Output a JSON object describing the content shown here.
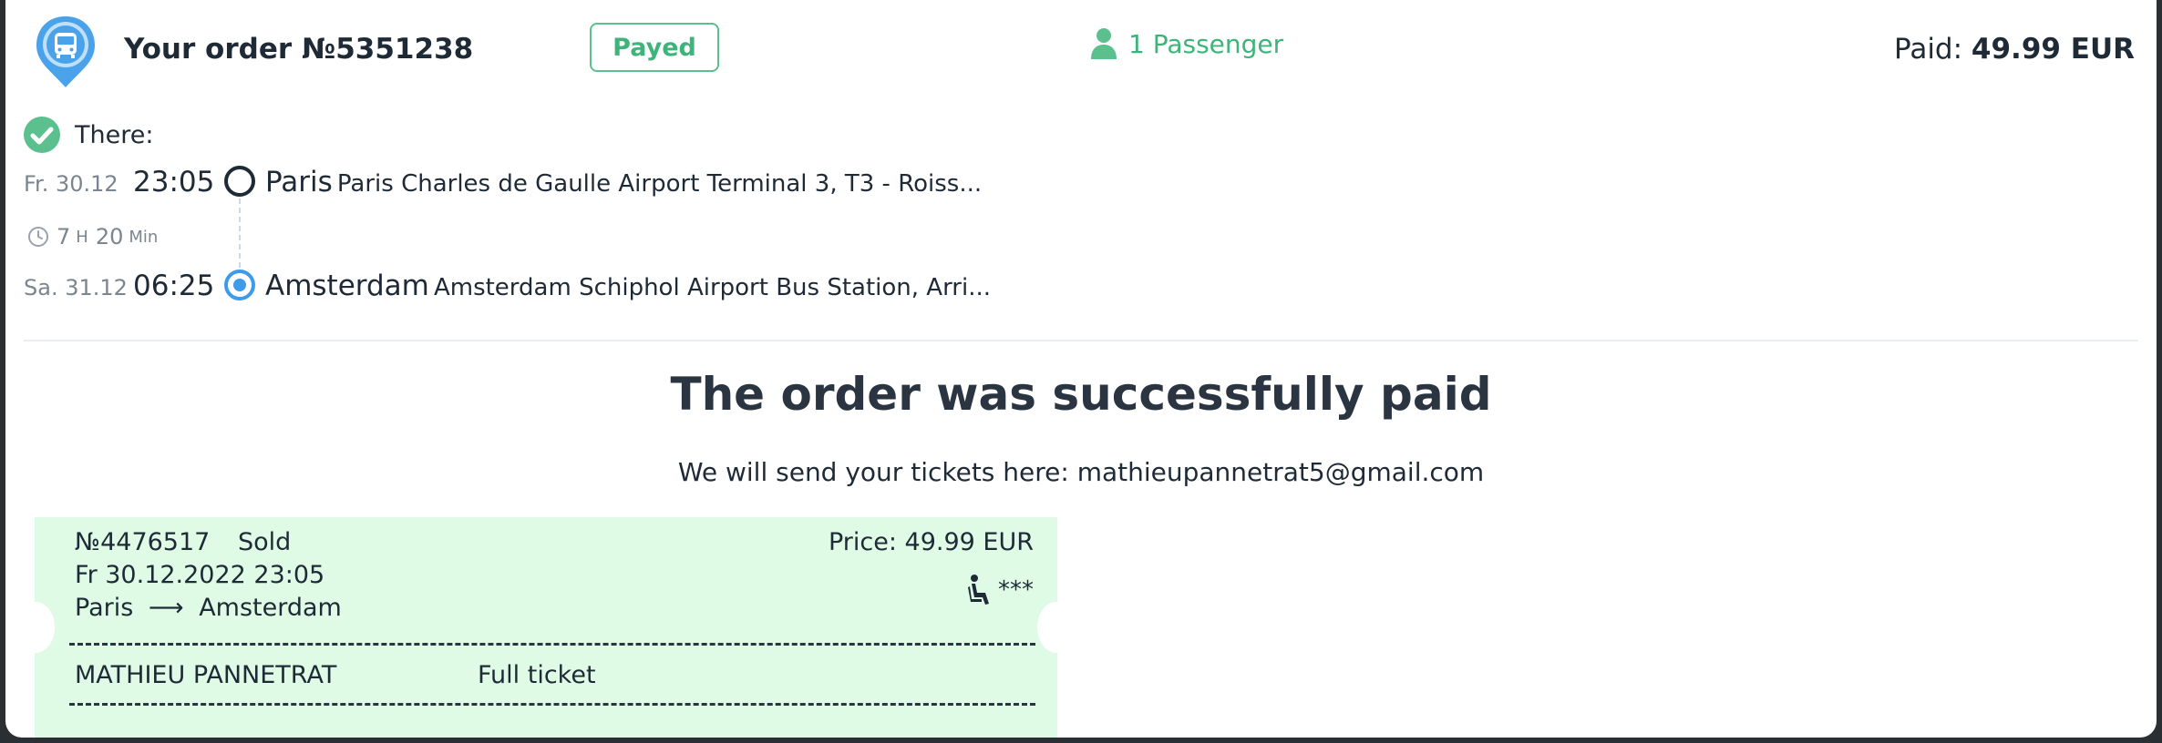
{
  "header": {
    "order_title": "Your order №5351238",
    "status": "Payed",
    "passengers": "1 Passenger",
    "paid_label": "Paid:",
    "paid_amount": "49.99 EUR"
  },
  "route": {
    "direction_label": "There:",
    "departure": {
      "date": "Fr. 30.12",
      "time": "23:05",
      "city": "Paris",
      "address": "Paris Charles de Gaulle Airport Terminal 3, T3 - Roiss..."
    },
    "duration": {
      "h": "7",
      "h_unit": "H",
      "m": "20",
      "m_unit": "Min"
    },
    "arrival": {
      "date": "Sa. 31.12",
      "time": "06:25",
      "city": "Amsterdam",
      "address": "Amsterdam Schiphol Airport Bus Station, Arri..."
    }
  },
  "success": {
    "title": "The order was successfully paid",
    "subtitle": "We will send your tickets here: mathieupannetrat5@gmail.com"
  },
  "ticket": {
    "number": "№4476517",
    "status": "Sold",
    "datetime": "Fr 30.12.2022 23:05",
    "from": "Paris",
    "arrow": "⟶",
    "to": "Amsterdam",
    "price": "Price: 49.99 EUR",
    "seat": "***",
    "passenger_name": "MATHIEU PANNETRAT",
    "ticket_type": "Full ticket"
  },
  "colors": {
    "accent_green": "#3fb47a",
    "accent_blue": "#3d9be9",
    "ticket_bg": "#dffbe6"
  },
  "icons": [
    "bus-pin-icon",
    "user-icon",
    "check-circle-icon",
    "clock-icon",
    "seat-icon"
  ]
}
